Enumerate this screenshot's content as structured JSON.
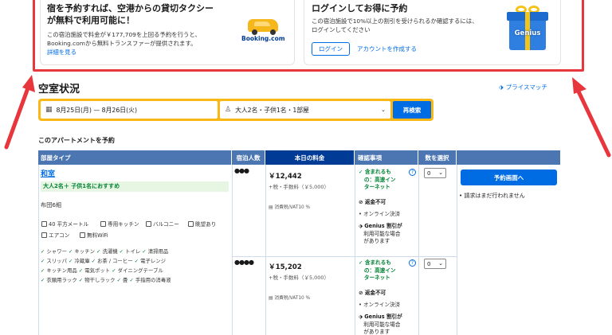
{
  "promo_taxi": {
    "title_line1": "宿を予約すれば、空港からの貸切タクシー",
    "title_line2": "が無料で利用可能に！",
    "text_line1": "この宿泊施設で料金が￥177,709を上回る予約を行うと、",
    "text_line2": "Booking.comから無料トランスファーが提供されます。",
    "link": "詳細を見る",
    "logo_text": "Booking.com"
  },
  "promo_login": {
    "title": "ログインしてお得に予約",
    "text_line1": "この宿泊施設で10%以上の割引を受けられるか確認するには、",
    "text_line2": "ログインしてください",
    "login_button": "ログイン",
    "create_account": "アカウントを作成する",
    "badge": "Genius"
  },
  "availability": {
    "title": "空室状況",
    "price_match": "プライスマッチ"
  },
  "search": {
    "dates": "8月25日(月) — 8月26日(火)",
    "guests": "大人2名・子供1名・1部屋",
    "button": "再検索"
  },
  "table": {
    "subtitle": "このアパートメントを予約",
    "headers": {
      "room_type": "部屋タイプ",
      "guests": "宿泊人数",
      "price_today": "本日の料金",
      "conditions": "確認事項",
      "select": "数を選択"
    },
    "room": {
      "name": "和室",
      "recommend": "大人2名＋ 子供1名におすすめ",
      "beds": "布団6組",
      "facilities": [
        "40 平方メートル",
        "専用キッチン",
        "バルコニー",
        "眺望あり",
        "エアコン",
        "無料WiFi"
      ],
      "amenities_row1": [
        "シャワー",
        "キッチン",
        "洗濯機",
        "トイレ",
        "清掃用品"
      ],
      "amenities_row2": [
        "スリッパ",
        "冷蔵庫",
        "お茶 / コーヒー",
        "電子レンジ"
      ],
      "amenities_row3": [
        "キッチン用品",
        "電気ポット",
        "ダイニングテーブル"
      ],
      "amenities_row4": [
        "衣類用ラック",
        "物干しラック",
        "畳",
        "手指用の消毒液"
      ]
    },
    "rates": [
      {
        "persons": "●●●",
        "price": "￥12,442",
        "tax": "+税・手数料（￥5,000）",
        "vat": "消費税/VAT10 %",
        "included_1": "含まれるも",
        "included_2": "の：高速イン",
        "included_3": "ターネット",
        "refund": "返金不可",
        "payment": "オンライン決済",
        "genius_1": "Genius 割引が",
        "genius_2": "利用可能な場合",
        "genius_3": "があります",
        "qty": "0"
      },
      {
        "persons": "●●●●",
        "price": "￥15,202",
        "tax": "+税・手数料（￥5,000）",
        "vat": "消費税/VAT10 %",
        "included_1": "含まれるも",
        "included_2": "の：高速イン",
        "included_3": "ターネット",
        "refund": "返金不可",
        "payment": "オンライン決済",
        "genius_1": "Genius 割引が",
        "genius_2": "利用可能な場合",
        "genius_3": "があります",
        "qty": "0"
      }
    ],
    "reserve_button": "予約画面へ",
    "reserve_note": "請求はまだ行われません"
  },
  "colors": {
    "accent_blue": "#006ce4",
    "header_blue": "#4c76b2",
    "dark_blue": "#003b95",
    "search_yellow": "#f9b816",
    "annotation_red": "#e8363d",
    "green": "#008234"
  }
}
